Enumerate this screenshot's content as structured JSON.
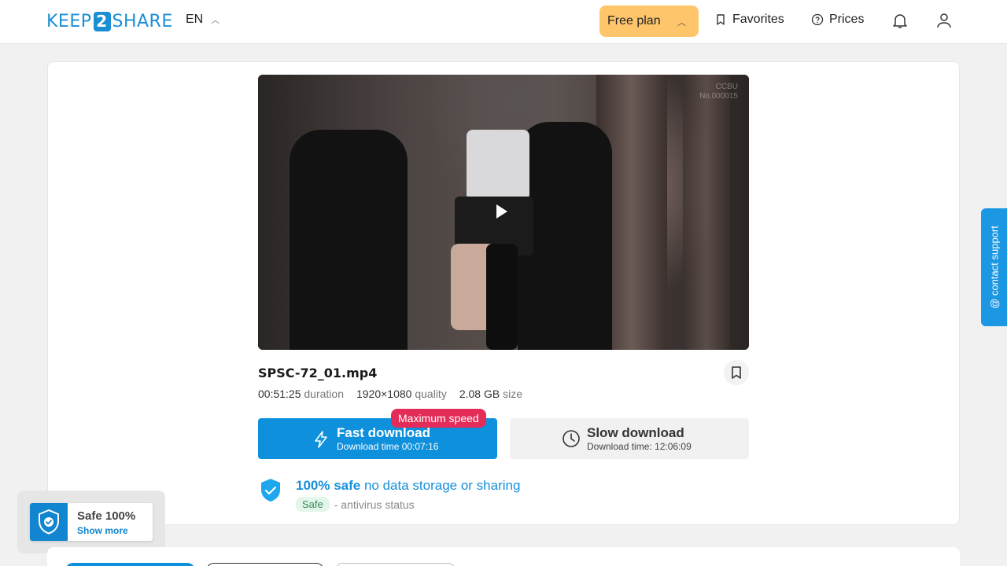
{
  "header": {
    "logo_left": "KEEP",
    "logo_mid": "2",
    "logo_right": "SHARE",
    "lang": "EN",
    "free_plan": "Free plan",
    "favorites": "Favorites",
    "prices": "Prices"
  },
  "video": {
    "watermark_line1": "CCBU",
    "watermark_line2": "No.000015"
  },
  "file": {
    "name": "SPSC-72_01.mp4",
    "duration_value": "00:51:25",
    "duration_label": "duration",
    "quality_value": "1920×1080",
    "quality_label": "quality",
    "size_value": "2.08 GB",
    "size_label": "size"
  },
  "download": {
    "max_badge": "Maximum speed",
    "fast_title": "Fast download",
    "fast_time": "Download time 00:07:16",
    "slow_title": "Slow download",
    "slow_time": "Download time: 12:06:09"
  },
  "safety": {
    "title_bold": "100% safe",
    "title_rest": "no data storage or sharing",
    "badge": "Safe",
    "status": "- antivirus status"
  },
  "safe_popup": {
    "title": "Safe 100%",
    "more": "Show more"
  },
  "support": {
    "label": "@ contact support"
  },
  "colors": {
    "accent": "#0e90dc",
    "free_plan": "#ffc56b",
    "max_badge": "#e42c58",
    "support": "#1b97e3"
  }
}
